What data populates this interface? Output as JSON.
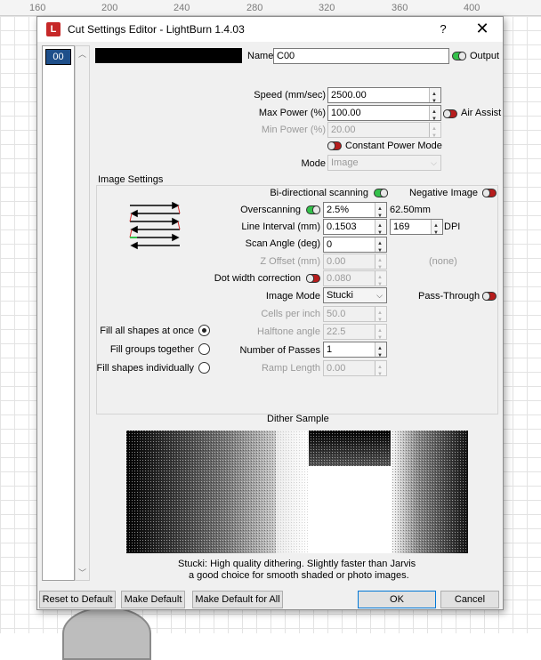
{
  "ruler": {
    "ticks": [
      "160",
      "200",
      "240",
      "280",
      "320",
      "360",
      "400"
    ]
  },
  "window": {
    "title": "Cut Settings Editor - LightBurn 1.4.03",
    "help_glyph": "?",
    "close_glyph": "✕"
  },
  "layer_list": {
    "selected_layer": "00"
  },
  "header": {
    "name_label": "Name",
    "name_value": "C00",
    "output_label": "Output",
    "output_on": true,
    "layer_color": "#000000"
  },
  "settings": {
    "speed_label": "Speed (mm/sec)",
    "speed_value": "2500.00",
    "max_power_label": "Max Power (%)",
    "max_power_value": "100.00",
    "air_assist_label": "Air Assist",
    "air_assist_on": false,
    "min_power_label": "Min Power (%)",
    "min_power_value": "20.00",
    "constant_power_label": "Constant Power Mode",
    "constant_power_on": false,
    "mode_label": "Mode",
    "mode_value": "Image"
  },
  "image_settings": {
    "group_title": "Image Settings",
    "bidirectional_label": "Bi-directional scanning",
    "bidirectional_on": true,
    "negative_label": "Negative Image",
    "negative_on": false,
    "overscanning_label": "Overscanning",
    "overscanning_on": true,
    "overscanning_value": "2.5%",
    "overscanning_mm": "62.50mm",
    "line_interval_label": "Line Interval (mm)",
    "line_interval_value": "0.1503",
    "dpi_value": "169",
    "dpi_label": "DPI",
    "scan_angle_label": "Scan Angle (deg)",
    "scan_angle_value": "0",
    "z_offset_label": "Z Offset (mm)",
    "z_offset_value": "0.00",
    "z_offset_note": "(none)",
    "dot_width_label": "Dot width correction",
    "dot_width_on": false,
    "dot_width_value": "0.080",
    "image_mode_label": "Image Mode",
    "image_mode_value": "Stucki",
    "pass_through_label": "Pass-Through",
    "pass_through_on": false,
    "cells_label": "Cells per inch",
    "cells_value": "50.0",
    "halftone_label": "Halftone angle",
    "halftone_value": "22.5",
    "passes_label": "Number of Passes",
    "passes_value": "1",
    "ramp_label": "Ramp Length",
    "ramp_value": "0.00",
    "fill_options": [
      {
        "label": "Fill all shapes at once",
        "selected": true
      },
      {
        "label": "Fill groups together",
        "selected": false
      },
      {
        "label": "Fill shapes individually",
        "selected": false
      }
    ]
  },
  "dither": {
    "title": "Dither Sample",
    "description_line1": "Stucki: High quality dithering. Slightly faster than Jarvis",
    "description_line2": "a good choice for smooth shaded or photo images."
  },
  "buttons": {
    "reset": "Reset to Default",
    "make_default": "Make Default",
    "make_default_all": "Make Default for All",
    "ok": "OK",
    "cancel": "Cancel"
  },
  "colors": {
    "toggle_on": "#33c14a",
    "toggle_off": "#b71c1c",
    "layer_chip": "#1e4f8a"
  }
}
